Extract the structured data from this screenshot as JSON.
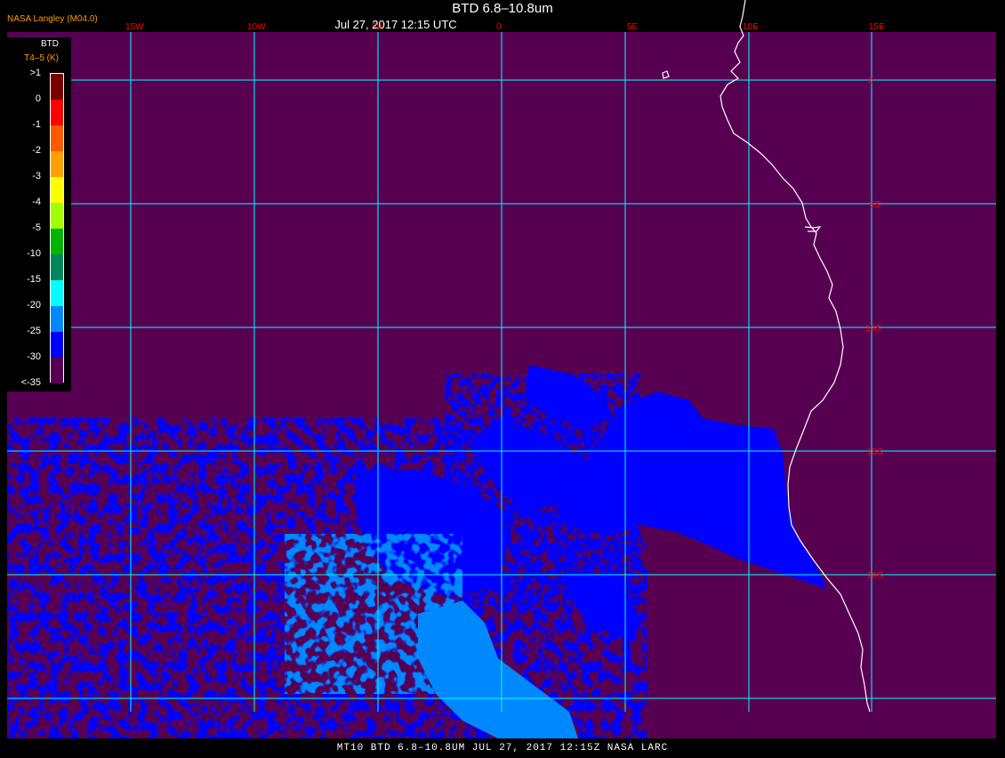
{
  "header": {
    "title": "BTD 6.8–10.8um",
    "datetime": "Jul 27, 2017 12:15 UTC",
    "brand": "NASA Langley (M04.0)"
  },
  "legend": {
    "title": "BTD",
    "subtitle": "T4–5 (K)",
    "labels": [
      ">1",
      "0",
      "-1",
      "-2",
      "-3",
      "-4",
      "-5",
      "-10",
      "-15",
      "-20",
      "-25",
      "-30",
      "<-35"
    ],
    "colors": [
      "#7a0000",
      "#ff0000",
      "#ff5a00",
      "#ffa000",
      "#ffff00",
      "#a0ff00",
      "#00b400",
      "#00865a",
      "#00ffff",
      "#0088ff",
      "#0000ff",
      "#570052"
    ]
  },
  "map": {
    "lon_labels": [
      "15W",
      "10W",
      "5W",
      "0",
      "5E",
      "10E",
      "15E"
    ],
    "lat_labels": [
      "0",
      "5S",
      "10S",
      "15S",
      "20S"
    ],
    "background_color": "#570052",
    "grid_color": "#00ffff",
    "label_color": "#ff0000",
    "coast_color": "#ffffff",
    "cloud_low_color": "#0000ff",
    "cloud_high_color": "#0088ff"
  },
  "footer": {
    "text": "MT10  BTD 6.8–10.8UM   JUL 27, 2017 12:15Z   NASA LARC"
  }
}
